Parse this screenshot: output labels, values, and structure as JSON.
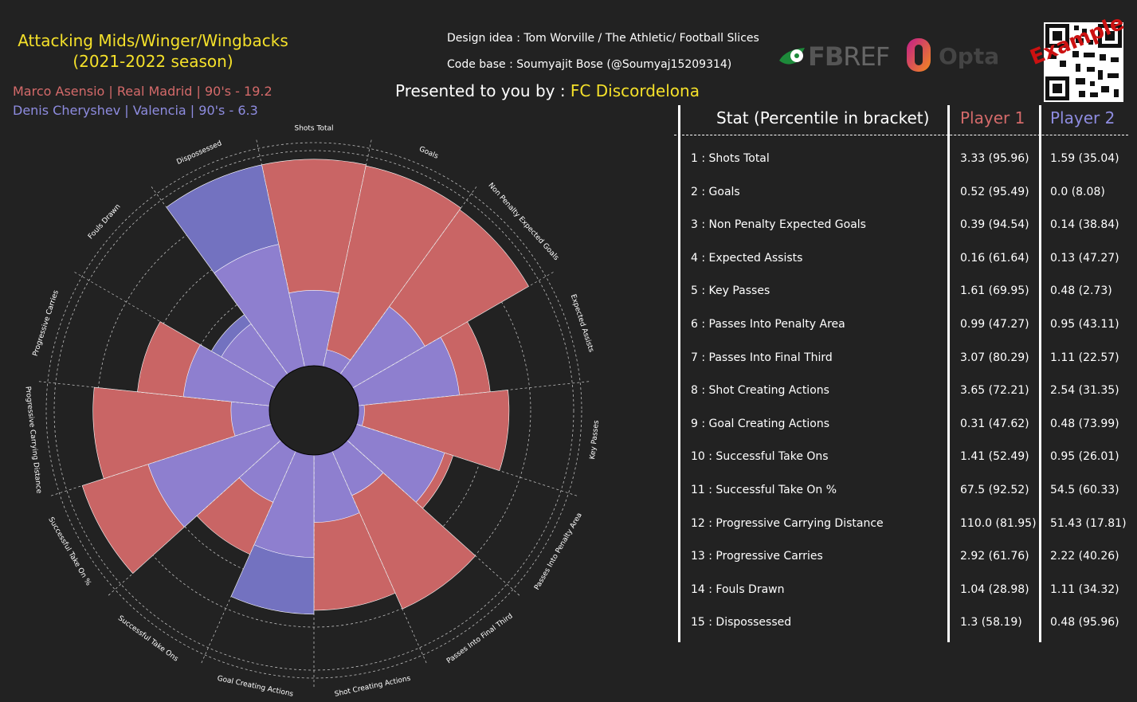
{
  "header": {
    "title_line1": "Attacking Mids/Winger/Wingbacks",
    "title_line2": "(2021-2022 season)",
    "player1_line": "Marco Asensio | Real Madrid | 90's - 19.2",
    "player2_line": "Denis Cheryshev | Valencia | 90's - 6.3",
    "design_credit": "Design idea :  Tom Worville / The Athletic/ Football Slices",
    "code_credit": "Code base :  Soumyajit Bose (@Soumyaj15209314)",
    "presented_prefix": "Presented to you by : ",
    "presented_brand": "FC Discordelona",
    "watermark": "Example",
    "logo_fbref_fb": "FB",
    "logo_fbref_ref": "REF",
    "logo_opta": "Opta"
  },
  "colors": {
    "background": "#222222",
    "player1": "#c96565",
    "player2": "#8e7fcf",
    "player2_outer": "#7372c0",
    "title": "#f5e12a"
  },
  "table": {
    "headers": [
      "Stat (Percentile in bracket)",
      "Player 1",
      "Player 2"
    ],
    "rows": [
      {
        "stat": "1 :  Shots Total",
        "p1": "3.33  (95.96)",
        "p2": "1.59  (35.04)"
      },
      {
        "stat": "2 :  Goals",
        "p1": "0.52  (95.49)",
        "p2": "0.0  (8.08)"
      },
      {
        "stat": "3 :  Non Penalty Expected Goals",
        "p1": "0.39  (94.54)",
        "p2": "0.14  (38.84)"
      },
      {
        "stat": "4 :  Expected Assists",
        "p1": "0.16  (61.64)",
        "p2": "0.13  (47.27)"
      },
      {
        "stat": "5 :  Key Passes",
        "p1": "1.61  (69.95)",
        "p2": "0.48  (2.73)"
      },
      {
        "stat": "6 :  Passes Into Penalty Area",
        "p1": "0.99  (47.27)",
        "p2": "0.95  (43.11)"
      },
      {
        "stat": "7 :  Passes Into Final Third",
        "p1": "3.07  (80.29)",
        "p2": "1.11  (22.57)"
      },
      {
        "stat": "8 :  Shot Creating Actions",
        "p1": "3.65  (72.21)",
        "p2": "2.54  (31.35)"
      },
      {
        "stat": "9 :  Goal Creating Actions",
        "p1": "0.31  (47.62)",
        "p2": "0.48  (73.99)"
      },
      {
        "stat": "10 :  Successful Take Ons",
        "p1": "1.41  (52.49)",
        "p2": "0.95  (26.01)"
      },
      {
        "stat": "11 :  Successful Take On %",
        "p1": "67.5  (92.52)",
        "p2": "54.5  (60.33)"
      },
      {
        "stat": "12 :  Progressive Carrying Distance",
        "p1": "110.0  (81.95)",
        "p2": "51.43  (17.81)"
      },
      {
        "stat": "13 :  Progressive Carries",
        "p1": "2.92  (61.76)",
        "p2": "2.22  (40.26)"
      },
      {
        "stat": "14 :  Fouls Drawn",
        "p1": "1.04  (28.98)",
        "p2": "1.11  (34.32)"
      },
      {
        "stat": "15 :  Dispossessed",
        "p1": "1.3  (58.19)",
        "p2": "0.48  (95.96)"
      }
    ]
  },
  "chart_data": {
    "type": "radar_bar",
    "categories": [
      "Shots Total",
      "Goals",
      "Non Penalty Expected Goals",
      "Expected Assists",
      "Key Passes",
      "Passes Into Penalty Area",
      "Passes Into Final Third",
      "Shot Creating Actions",
      "Goal Creating Actions",
      "Successful Take Ons",
      "Successful Take On %",
      "Progressive Carrying Distance",
      "Progressive Carries",
      "Fouls Drawn",
      "Dispossessed"
    ],
    "series": [
      {
        "name": "Marco Asensio",
        "values": [
          95.96,
          95.49,
          94.54,
          61.64,
          69.95,
          47.27,
          80.29,
          72.21,
          47.62,
          52.49,
          92.52,
          81.95,
          61.76,
          28.98,
          58.19
        ]
      },
      {
        "name": "Denis Cheryshev",
        "values": [
          35.04,
          8.08,
          38.84,
          47.27,
          2.73,
          43.11,
          22.57,
          31.35,
          73.99,
          26.01,
          60.33,
          17.81,
          40.26,
          34.32,
          95.96
        ]
      }
    ],
    "ylim": [
      0,
      100
    ],
    "grid": true
  }
}
